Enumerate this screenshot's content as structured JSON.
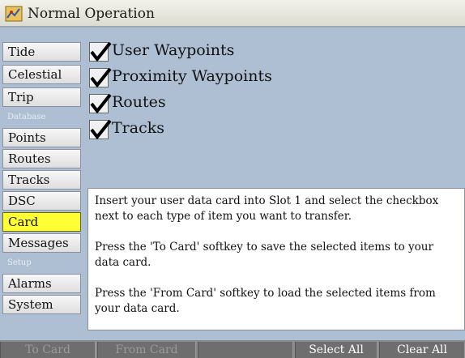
{
  "window": {
    "title": "Normal Operation"
  },
  "sidebar": {
    "items": [
      {
        "label": "Tide"
      },
      {
        "label": "Celestial"
      },
      {
        "label": "Trip"
      },
      {
        "label": "Database",
        "header": true
      },
      {
        "label": "Points"
      },
      {
        "label": "Routes"
      },
      {
        "label": "Tracks"
      },
      {
        "label": "DSC"
      },
      {
        "label": "Card",
        "active": true
      },
      {
        "label": "Messages"
      },
      {
        "label": "Setup",
        "header": true
      },
      {
        "label": "Alarms"
      },
      {
        "label": "System"
      }
    ]
  },
  "checklist": {
    "items": [
      {
        "label": "User Waypoints",
        "checked": true
      },
      {
        "label": "Proximity Waypoints",
        "checked": true
      },
      {
        "label": "Routes",
        "checked": true
      },
      {
        "label": "Tracks",
        "checked": true
      }
    ]
  },
  "info": {
    "p1": "Insert your user data card into Slot 1 and select the checkbox next to each type of item you want to transfer.",
    "p2": "Press the 'To Card' softkey to save the selected items to your data card.",
    "p3": "Press the 'From Card' softkey to load the selected items from your data card."
  },
  "softkeys": {
    "to_card": "To Card",
    "from_card": "From Card",
    "blank": "",
    "select_all": "Select All",
    "clear_all": "Clear All"
  },
  "colors": {
    "background": "#aebfd4",
    "active_item": "#ffff33",
    "softkey_bar": "#6e6e6e"
  },
  "icons": {
    "app": "chart-icon",
    "check": "checkmark-icon"
  }
}
